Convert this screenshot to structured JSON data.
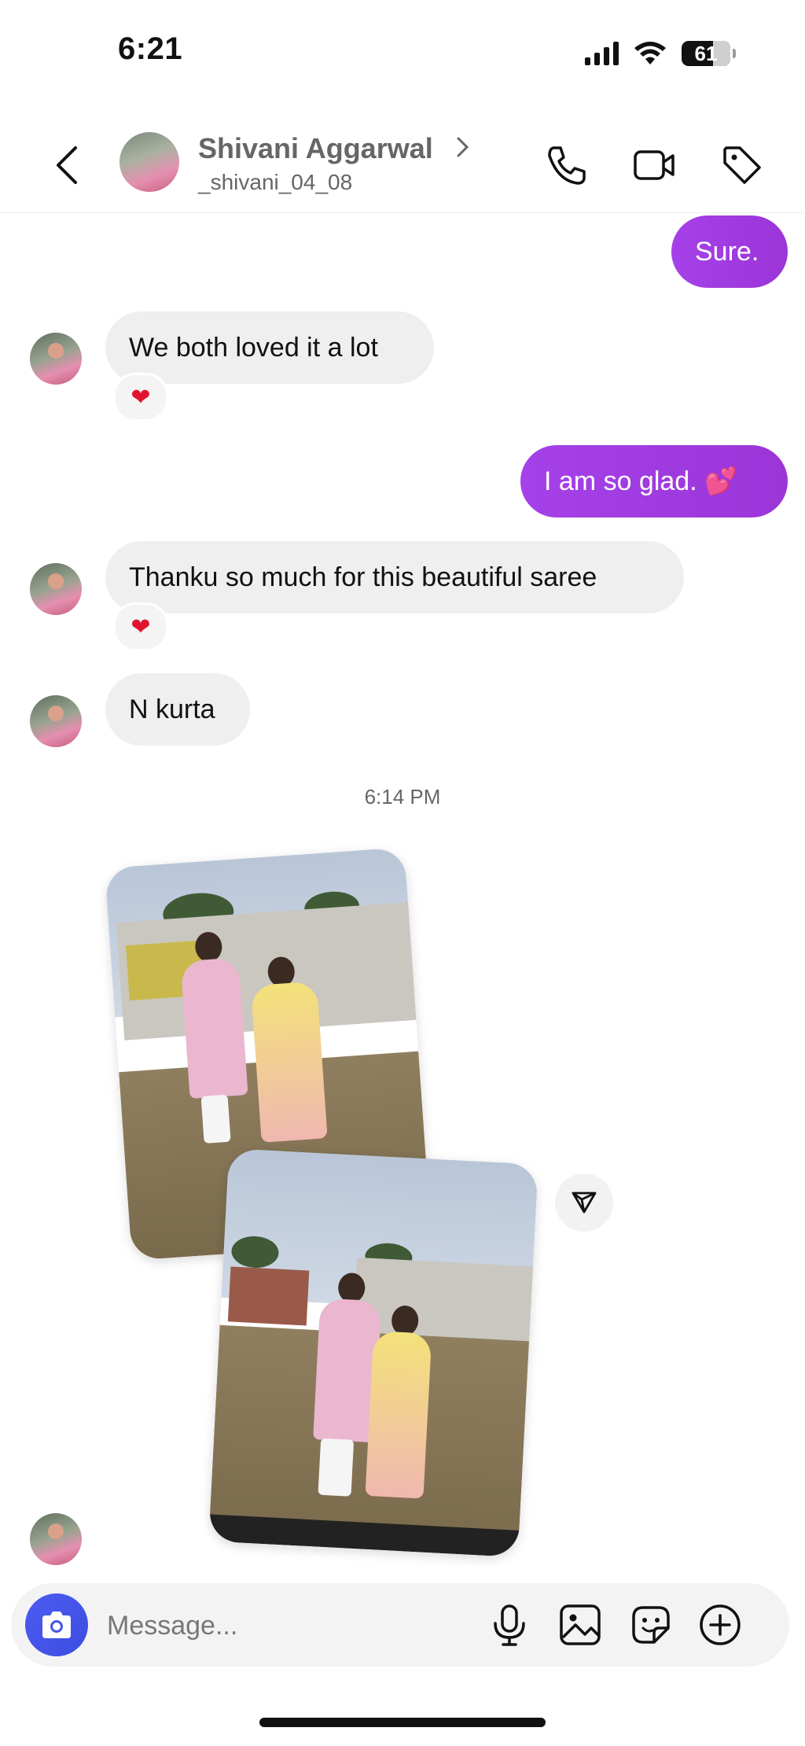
{
  "status_bar": {
    "time": "6:21",
    "battery": "61"
  },
  "header": {
    "name": "Shivani Aggarwal",
    "username": "_shivani_04_08",
    "back_icon": "chevron-left-icon",
    "call_icon": "phone-icon",
    "video_icon": "video-camera-icon",
    "tag_icon": "tag-icon"
  },
  "messages": [
    {
      "direction": "outgoing",
      "text": "Sure."
    },
    {
      "direction": "incoming",
      "text": "We both loved it a lot",
      "reaction": "❤"
    },
    {
      "direction": "outgoing",
      "text": "I am so glad. 💕"
    },
    {
      "direction": "incoming",
      "text": "Thanku so much for this beautiful saree",
      "reaction": "❤"
    },
    {
      "direction": "incoming",
      "text": "N kurta"
    }
  ],
  "timestamp": "6:14 PM",
  "composer": {
    "placeholder": "Message..."
  },
  "colors": {
    "outgoing_bubble": "#a13ae1",
    "incoming_bubble": "#efefef",
    "camera_button": "#4556e8"
  }
}
